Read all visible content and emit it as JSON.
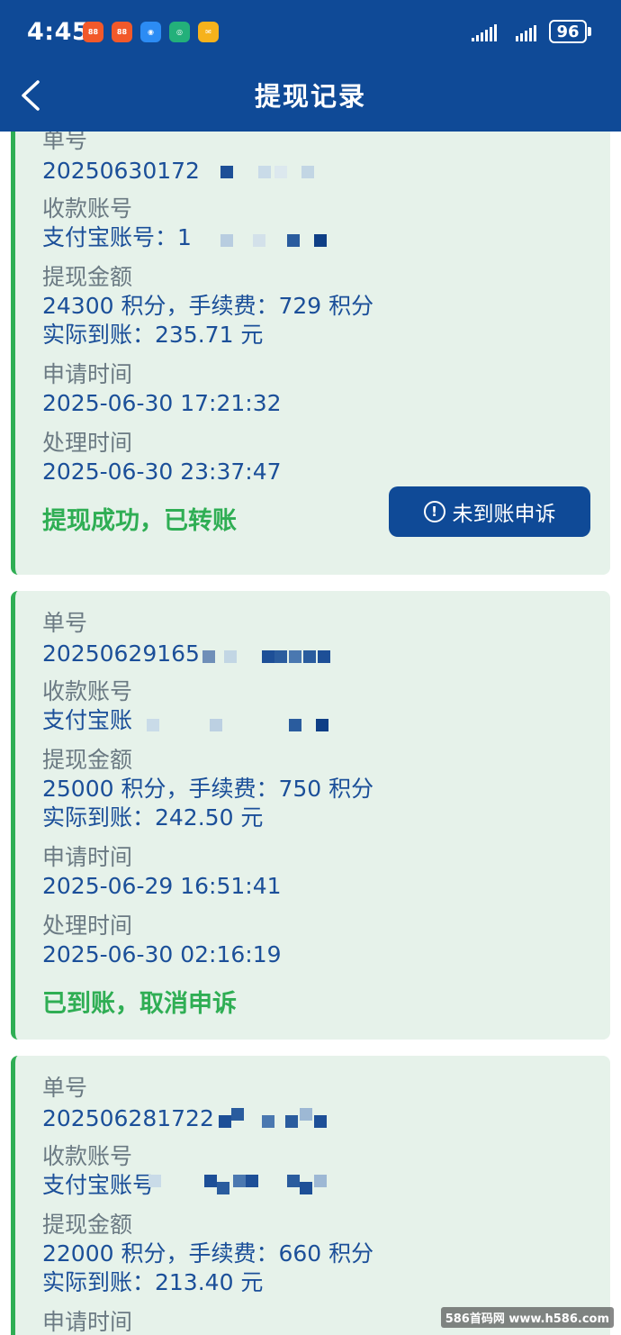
{
  "status_bar": {
    "time": "4:45",
    "battery": "96",
    "network": "5G"
  },
  "header": {
    "title": "提现记录"
  },
  "colors": {
    "header_bg": "#0f4a97",
    "card_bg": "#e6f2ea",
    "accent_green": "#2fae54",
    "value_blue": "#1b4f99"
  },
  "records": [
    {
      "order_label": "单号",
      "order_no": "20250630172",
      "account_label": "收款账号",
      "account": "支付宝账号：1",
      "amount_label": "提现金额",
      "amount": "24300 积分，手续费：729 积分",
      "received": "实际到账：235.71 元",
      "apply_label": "申请时间",
      "apply_time": "2025-06-30 17:21:32",
      "process_label": "处理时间",
      "process_time": "2025-06-30 23:37:47",
      "status": "提现成功，已转账",
      "appeal_button": "未到账申诉"
    },
    {
      "order_label": "单号",
      "order_no": "20250629165",
      "account_label": "收款账号",
      "account": "支付宝账",
      "amount_label": "提现金额",
      "amount": "25000 积分，手续费：750 积分",
      "received": "实际到账：242.50 元",
      "apply_label": "申请时间",
      "apply_time": "2025-06-29 16:51:41",
      "process_label": "处理时间",
      "process_time": "2025-06-30 02:16:19",
      "status": "已到账，取消申诉"
    },
    {
      "order_label": "单号",
      "order_no": "202506281722",
      "account_label": "收款账号",
      "account": "支付宝账号",
      "amount_label": "提现金额",
      "amount": "22000 积分，手续费：660 积分",
      "received": "实际到账：213.40 元",
      "apply_label": "申请时间"
    }
  ],
  "watermark": "586首码网 www.h586.com"
}
